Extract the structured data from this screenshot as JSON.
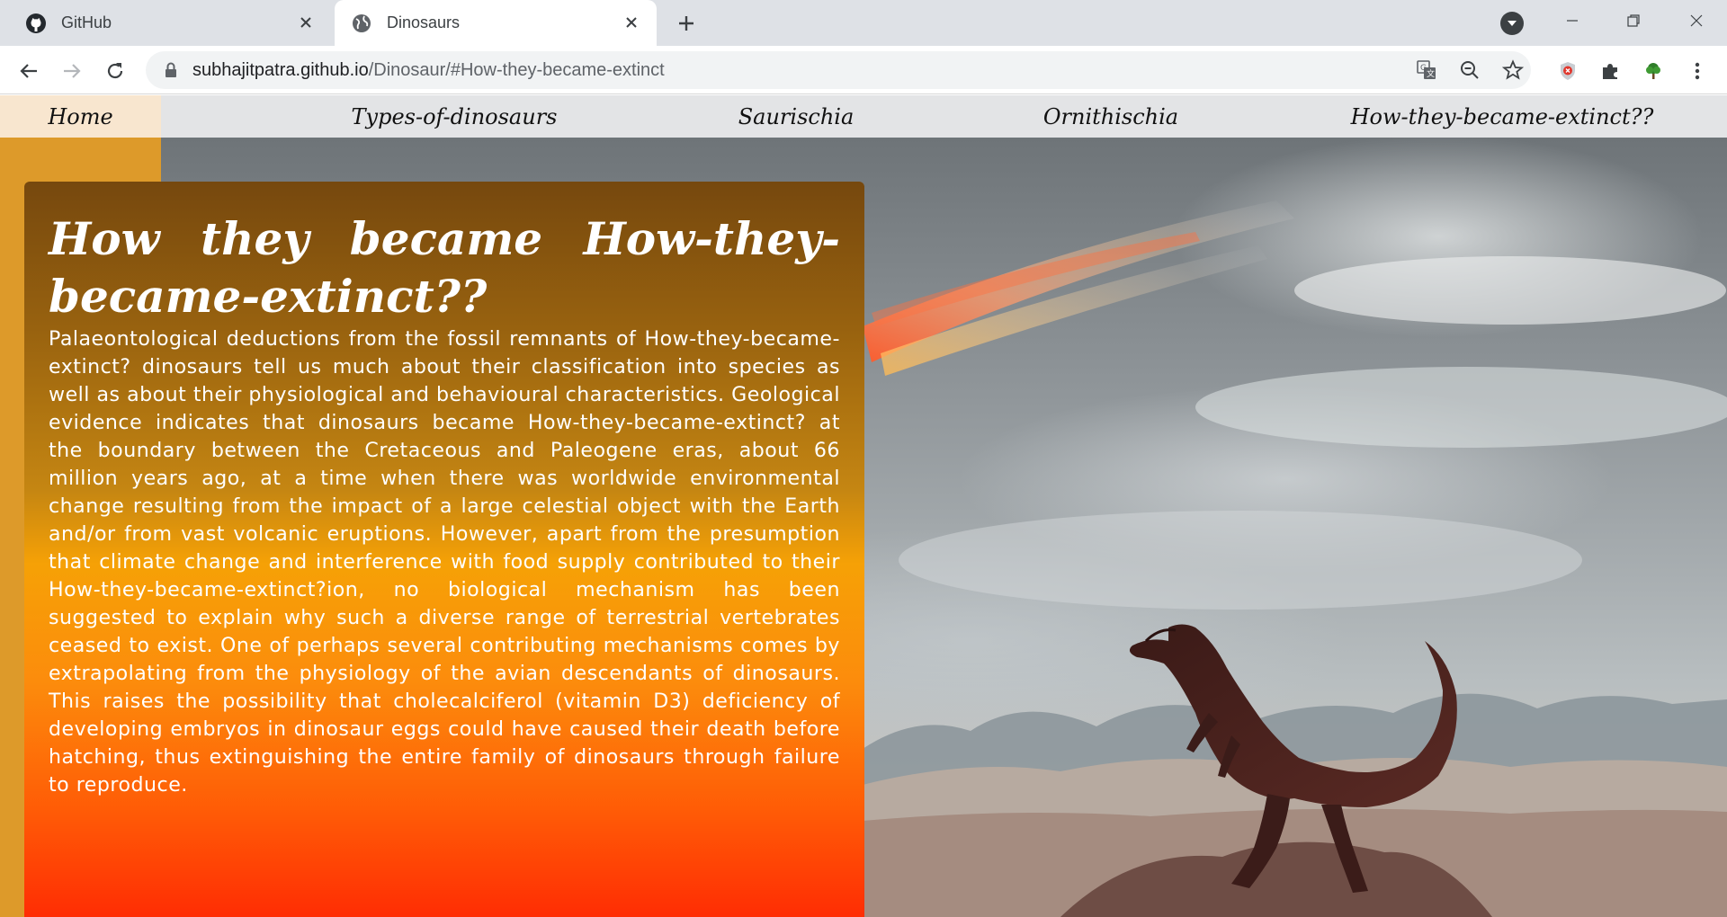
{
  "browser": {
    "tabs": [
      {
        "title": "GitHub",
        "favicon": "github-icon",
        "active": false
      },
      {
        "title": "Dinosaurs",
        "favicon": "globe-icon",
        "active": true
      }
    ],
    "address": {
      "host": "subhajitpatra.github.io",
      "path": "/Dinosaur/#How-they-became-extinct"
    }
  },
  "nav": {
    "items": [
      "Home",
      "Types-of-dinosaurs",
      "Saurischia",
      "Ornithischia",
      "How-they-became-extinct??"
    ]
  },
  "article": {
    "title": "How they became How-they-became-extinct??",
    "body": "Palaeontological deductions from the fossil remnants of How-they-became-extinct? dinosaurs tell us much about their classification into species as well as about their physiological and behavioural characteristics. Geological evidence indicates that dinosaurs became How-they-became-extinct? at the boundary between the Cretaceous and Paleogene eras, about 66 million years ago, at a time when there was worldwide environmental change resulting from the impact of a large celestial object with the Earth and/or from vast volcanic eruptions. However, apart from the presumption that climate change and interference with food supply contributed to their How-they-became-extinct?ion, no biological mechanism has been suggested to explain why such a diverse range of terrestrial vertebrates ceased to exist. One of perhaps several contributing mechanisms comes by extrapolating from the physiology of the avian descendants of dinosaurs. This raises the possibility that cholecalciferol (vitamin D3) deficiency of developing embryos in dinosaur eggs could have caused their death before hatching, thus extinguishing the entire family of dinosaurs through failure to reproduce."
  },
  "colors": {
    "panel_top": "#76480e",
    "panel_mid": "#f6a106",
    "panel_bottom": "#ff2d04",
    "sidebar_strip": "#dd9a2a",
    "nav_bar": "#e3e4e6",
    "nav_home": "#f8e6cf"
  }
}
